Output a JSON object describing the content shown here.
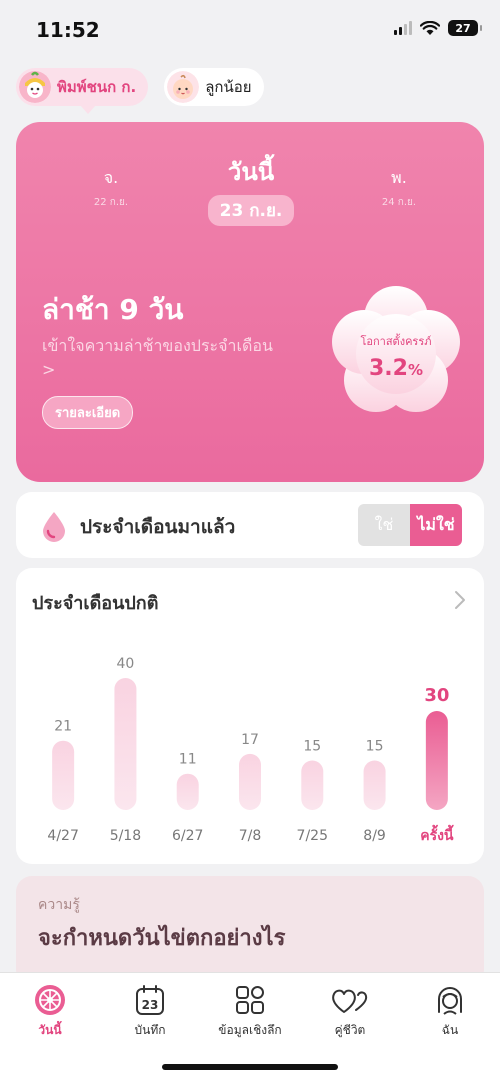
{
  "status_bar": {
    "time": "11:52",
    "battery": "27"
  },
  "profiles": [
    {
      "name": "พิมพ์ชนก ก.",
      "active": true
    },
    {
      "name": "ลูกน้อย",
      "active": false
    }
  ],
  "hero": {
    "prev_day": {
      "name": "จ.",
      "date": "22 ก.ย."
    },
    "today": {
      "label": "วันนี้",
      "date": "23 ก.ย."
    },
    "next_day": {
      "name": "พ.",
      "date": "24 ก.ย."
    },
    "late_title": "ล่าช้า 9 วัน",
    "late_subtitle": "เข้าใจความล่าช้าของประจำเดือน",
    "late_subtitle_chevron": ">",
    "detail_button": "รายละเอียด",
    "pregnancy_label": "โอกาสตั้งครรภ์",
    "pregnancy_value": "3.2",
    "pregnancy_unit": "%"
  },
  "period_card": {
    "title": "ประจำเดือนมาแล้ว",
    "yes_label": "ใช่",
    "no_label": "ไม่ใช่"
  },
  "chart_card": {
    "title": "ประจำเดือนปกติ"
  },
  "chart_data": {
    "type": "bar",
    "categories": [
      "4/27",
      "5/18",
      "6/27",
      "7/8",
      "7/25",
      "8/9",
      "ครั้งนี้"
    ],
    "values": [
      21,
      40,
      11,
      17,
      15,
      15,
      30
    ],
    "highlight_index": 6,
    "title": "ประจำเดือนปกติ",
    "xlabel": "",
    "ylabel": "",
    "ylim": [
      0,
      40
    ],
    "grid": false,
    "colors": {
      "bar": "#f9d3e1",
      "highlight": "#ea5d93",
      "value_text": "#888888",
      "highlight_text": "#e2457f"
    }
  },
  "knowledge": {
    "label": "ความรู้",
    "title": "จะกำหนดวันไข่ตกอย่างไร"
  },
  "tabs": [
    {
      "label": "วันนี้",
      "icon": "today-icon",
      "active": true
    },
    {
      "label": "บันทึก",
      "icon": "calendar-icon",
      "calendar_day": "23",
      "active": false
    },
    {
      "label": "ข้อมูลเชิงลึก",
      "icon": "insights-icon",
      "active": false
    },
    {
      "label": "คู่ชีวิต",
      "icon": "partner-hearts-icon",
      "active": false
    },
    {
      "label": "ฉัน",
      "icon": "profile-icon",
      "active": false
    }
  ],
  "colors": {
    "accent": "#ea5d93",
    "hero_top": "#f084ad",
    "hero_bottom": "#ea6a9e"
  }
}
